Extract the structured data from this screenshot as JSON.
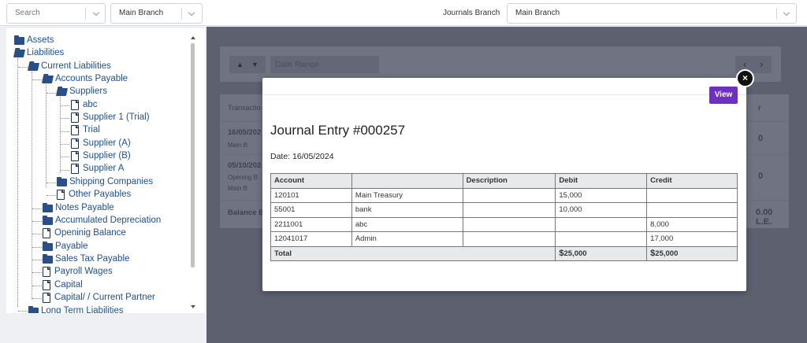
{
  "topbar": {
    "search_placeholder": "Search",
    "branch_filter_value": "Main Branch",
    "journals_branch_label": "Journals Branch",
    "journals_branch_value": "Main Branch"
  },
  "tree": {
    "items": [
      {
        "label": "Assets",
        "icon": "folder-icon"
      },
      {
        "label": "Liabilities",
        "icon": "folder-open-icon"
      },
      {
        "label": "Current Liabilities",
        "icon": "folder-open-icon"
      },
      {
        "label": "Accounts Payable",
        "icon": "folder-open-icon"
      },
      {
        "label": "Suppliers",
        "icon": "folder-open-icon"
      },
      {
        "label": "abc",
        "icon": "file-icon"
      },
      {
        "label": "Supplier 1 (Trial)",
        "icon": "file-icon"
      },
      {
        "label": "Trial",
        "icon": "file-icon"
      },
      {
        "label": "Supplier (A)",
        "icon": "file-icon"
      },
      {
        "label": "Supplier (B)",
        "icon": "file-icon"
      },
      {
        "label": "Supplier A",
        "icon": "file-icon"
      },
      {
        "label": "Shipping Companies",
        "icon": "folder-icon"
      },
      {
        "label": "Other Payables",
        "icon": "file-icon"
      },
      {
        "label": "Notes Payable",
        "icon": "folder-icon"
      },
      {
        "label": "Accumulated Depreciation",
        "icon": "folder-icon"
      },
      {
        "label": "Openinig Balance",
        "icon": "file-icon"
      },
      {
        "label": "Payable",
        "icon": "folder-icon"
      },
      {
        "label": "Sales Tax Payable",
        "icon": "folder-icon"
      },
      {
        "label": "Payroll Wages",
        "icon": "file-icon"
      },
      {
        "label": "Capital",
        "icon": "file-icon"
      },
      {
        "label": "Capital/ / Current Partner",
        "icon": "file-icon"
      },
      {
        "label": "Long Term Liabilities",
        "icon": "folder-icon"
      }
    ]
  },
  "background": {
    "date_range_placeholder": "Date Range",
    "col_transaction": "Transactio",
    "col_right": "r",
    "row1_date": "16/05/202",
    "row1_branch": "Main B",
    "row1_amount": "0",
    "row2_date": "05/10/202",
    "row2_sub": "Opening B",
    "row2_branch": "Main B",
    "row2_amount": "0",
    "balance_label": "Balance B",
    "balance_amount": "0.00 L.E."
  },
  "modal": {
    "view_label": "View",
    "close_label": "×",
    "title": "Journal Entry #000257",
    "date": "Date: 16/05/2024",
    "table": {
      "headers": [
        "Account",
        "",
        "Description",
        "Debit",
        "Credit"
      ],
      "rows": [
        [
          "120101",
          "Main Treasury",
          "",
          "15,000",
          ""
        ],
        [
          "55001",
          "bank",
          "",
          "10,000",
          ""
        ],
        [
          "2211001",
          "abc",
          "",
          "",
          "8,000"
        ],
        [
          "12041017",
          "Admin",
          "",
          "",
          "17,000"
        ]
      ],
      "total_label": "Total",
      "currency_symbol": "$",
      "total_debit": "25,000",
      "total_credit": "25,000"
    }
  }
}
